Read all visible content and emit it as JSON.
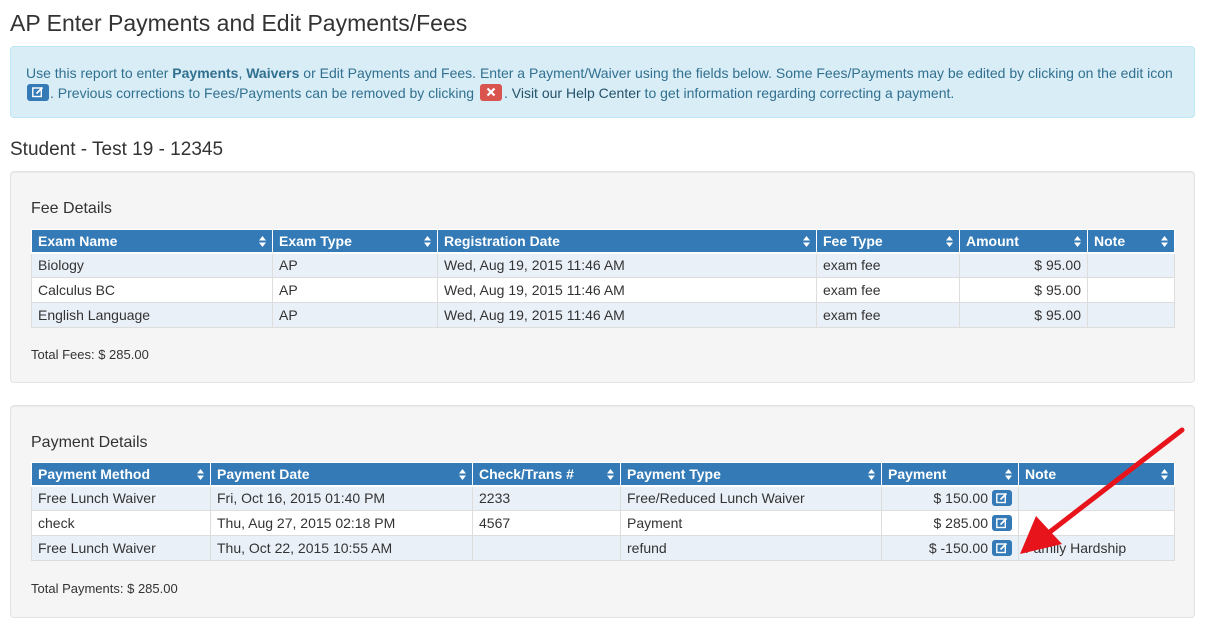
{
  "page": {
    "title": "AP Enter Payments and Edit Payments/Fees"
  },
  "info": {
    "text1": "Use this report to enter ",
    "bold1": "Payments",
    "sep1": ", ",
    "bold2": "Waivers",
    "text2": " or Edit Payments and Fees. Enter a Payment/Waiver using the fields below. Some Fees/Payments may be edited by clicking on the edit icon ",
    "text3": ". Previous corrections to Fees/Payments can be removed by clicking ",
    "text4": ". ",
    "link": "Visit our Help Center",
    "text5": " to get information regarding correcting a payment."
  },
  "student": {
    "title": "Student - Test 19 - 12345"
  },
  "fees": {
    "title": "Fee Details",
    "columns": [
      "Exam Name",
      "Exam Type",
      "Registration Date",
      "Fee Type",
      "Amount",
      "Note"
    ],
    "rows": [
      [
        "Biology",
        "AP",
        "Wed, Aug 19, 2015 11:46 AM",
        "exam fee",
        "$ 95.00",
        ""
      ],
      [
        "Calculus BC",
        "AP",
        "Wed, Aug 19, 2015 11:46 AM",
        "exam fee",
        "$ 95.00",
        ""
      ],
      [
        "English Language",
        "AP",
        "Wed, Aug 19, 2015 11:46 AM",
        "exam fee",
        "$ 95.00",
        ""
      ]
    ],
    "total": "Total Fees: $ 285.00"
  },
  "payments": {
    "title": "Payment Details",
    "columns": [
      "Payment Method",
      "Payment Date",
      "Check/Trans #",
      "Payment Type",
      "Payment",
      "Note"
    ],
    "rows": [
      [
        "Free Lunch Waiver",
        "Fri, Oct 16, 2015 01:40 PM",
        "2233",
        "Free/Reduced Lunch Waiver",
        "$ 150.00",
        ""
      ],
      [
        "check",
        "Thu, Aug 27, 2015 02:18 PM",
        "4567",
        "Payment",
        "$ 285.00",
        ""
      ],
      [
        "Free Lunch Waiver",
        "Thu, Oct 22, 2015 10:55 AM",
        "",
        "refund",
        "$ -150.00",
        "Family Hardship"
      ]
    ],
    "total": "Total Payments: $ 285.00"
  },
  "colors": {
    "header_blue": "#337ab7",
    "info_bg": "#d9edf7",
    "info_text": "#31708f",
    "delete_red": "#d9534f",
    "arrow_red": "#e8141b"
  },
  "icons": {
    "edit": "edit-icon",
    "delete": "delete-icon",
    "sort": "sort-icon",
    "arrow": "red-arrow"
  }
}
